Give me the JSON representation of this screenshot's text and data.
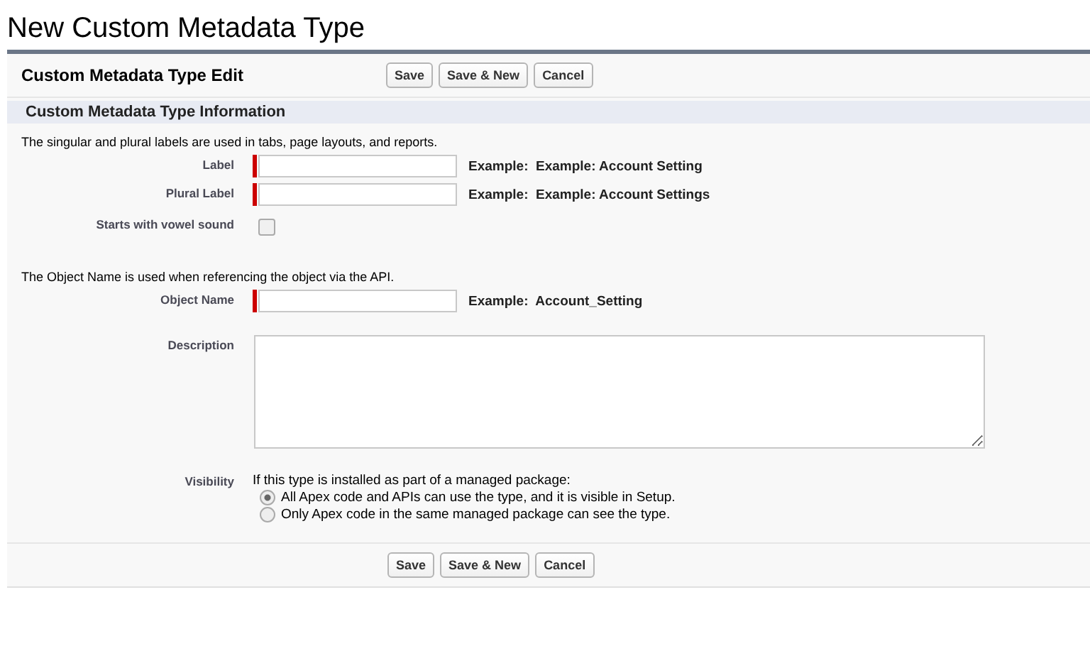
{
  "page_title": "New Custom Metadata Type",
  "panel": {
    "title": "Custom Metadata Type Edit",
    "buttons": [
      "Save",
      "Save & New",
      "Cancel"
    ]
  },
  "section": {
    "title": "Custom Metadata Type Information"
  },
  "groups": [
    {
      "intro": "The singular and plural labels are used in tabs, page layouts, and reports.",
      "fields": [
        {
          "kind": "text",
          "label": "Label",
          "required": true,
          "hint": "Example:  Example: Account Setting"
        },
        {
          "kind": "text",
          "label": "Plural Label",
          "required": true,
          "hint": "Example:  Example: Account Settings"
        },
        {
          "kind": "checkbox",
          "label": "Starts with vowel sound",
          "checked": false
        }
      ]
    },
    {
      "intro": "The Object Name is used when referencing the object via the API.",
      "fields": [
        {
          "kind": "text",
          "label": "Object Name",
          "required": true,
          "hint": "Example:  Account_Setting"
        },
        {
          "kind": "textarea",
          "label": "Description"
        },
        {
          "kind": "radio",
          "label": "Visibility",
          "question": "If this type is installed as part of a managed package:",
          "options": [
            {
              "label": "All Apex code and APIs can use the type, and it is visible in Setup.",
              "selected": true
            },
            {
              "label": "Only Apex code in the same managed package can see the type.",
              "selected": false
            }
          ]
        }
      ]
    }
  ],
  "footer_buttons": [
    "Save",
    "Save & New",
    "Cancel"
  ]
}
